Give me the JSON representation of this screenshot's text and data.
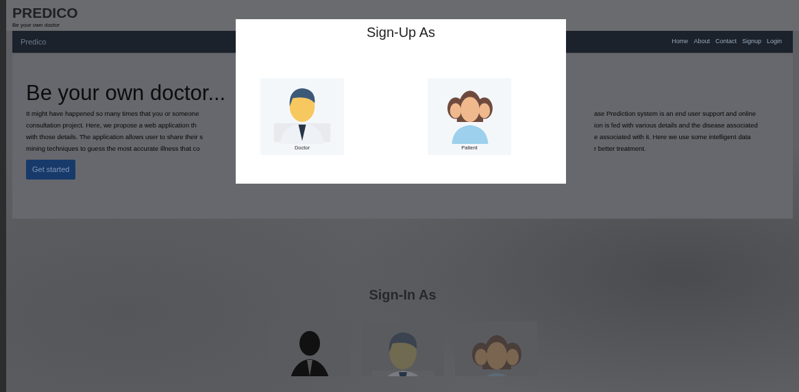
{
  "header": {
    "title": "PREDICO",
    "tagline": "Be your own doctor"
  },
  "navbar": {
    "brand": "Predico",
    "links": [
      {
        "label": "Home"
      },
      {
        "label": "About"
      },
      {
        "label": "Contact"
      },
      {
        "label": "Signup"
      },
      {
        "label": "Login"
      }
    ]
  },
  "hero": {
    "heading": "Be your own doctor...",
    "paragraph_lines": [
      {
        "left": "It might have happened so many times that you or someone",
        "right": "ase Prediction system is an end user support and online"
      },
      {
        "left": "consultation project. Here, we propose a web application th",
        "right": "ion is fed with various details and the disease associated"
      },
      {
        "left": "with those details. The application allows user to share their s",
        "right": "e associated with it. Here we use some intelligent data"
      },
      {
        "left": "mining techniques to guess the most accurate illness that co",
        "right": "r better treatment."
      }
    ],
    "button": "Get started"
  },
  "sign_in": {
    "title": "Sign-In As",
    "options": [
      {
        "kind": "admin"
      },
      {
        "kind": "doctor"
      },
      {
        "kind": "patient"
      }
    ]
  },
  "modal": {
    "title": "Sign-Up As",
    "options": [
      {
        "kind": "doctor",
        "label": "Doctor"
      },
      {
        "kind": "patient",
        "label": "Patient"
      }
    ]
  }
}
